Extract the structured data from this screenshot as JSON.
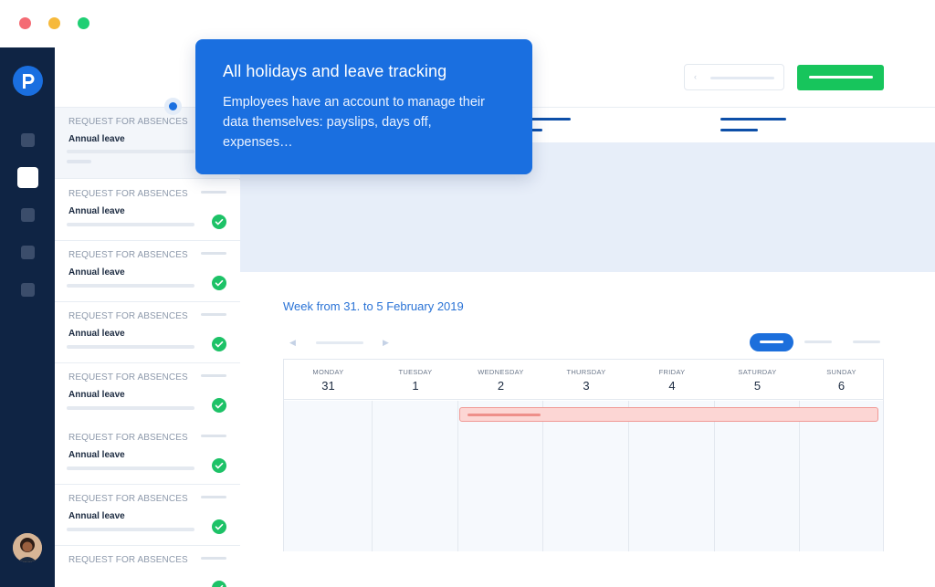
{
  "tooltip": {
    "title": "All holidays and leave tracking",
    "body": "Employees have an account to manage their data themselves: payslips, days off, expenses…"
  },
  "requests": [
    {
      "kicker": "REQUEST FOR ABSENCES",
      "title": "Annual leave",
      "approved": false
    },
    {
      "kicker": "REQUEST FOR ABSENCES",
      "title": "Annual leave",
      "approved": true
    },
    {
      "kicker": "REQUEST FOR ABSENCES",
      "title": "Annual leave",
      "approved": true
    },
    {
      "kicker": "REQUEST FOR ABSENCES",
      "title": "Annual leave",
      "approved": true
    },
    {
      "kicker": "REQUEST FOR ABSENCES",
      "title": "Annual leave",
      "approved": true
    },
    {
      "kicker": "REQUEST FOR ABSENCES",
      "title": "Annual leave",
      "approved": true
    },
    {
      "kicker": "REQUEST FOR ABSENCES",
      "title": "Annual leave",
      "approved": true
    },
    {
      "kicker": "REQUEST FOR ABSENCES",
      "title": "",
      "approved": true
    }
  ],
  "calendar": {
    "week_title": "Week from 31. to 5 February 2019",
    "days": [
      {
        "name": "MONDAY",
        "num": "31"
      },
      {
        "name": "TUESDAY",
        "num": "1"
      },
      {
        "name": "WEDNESDAY",
        "num": "2"
      },
      {
        "name": "THURSDAY",
        "num": "3"
      },
      {
        "name": "FRIDAY",
        "num": "4"
      },
      {
        "name": "SATURDAY",
        "num": "5"
      },
      {
        "name": "SUNDAY",
        "num": "6"
      }
    ]
  },
  "icons": {
    "logo": "brand-p-logo",
    "approved": "check-icon",
    "prev": "chevron-left-icon",
    "next": "chevron-right-icon"
  },
  "colors": {
    "accent": "#1a6fe0",
    "sidebar": "#0f2444",
    "success": "#17c55c",
    "event": "#fcd6d4"
  }
}
